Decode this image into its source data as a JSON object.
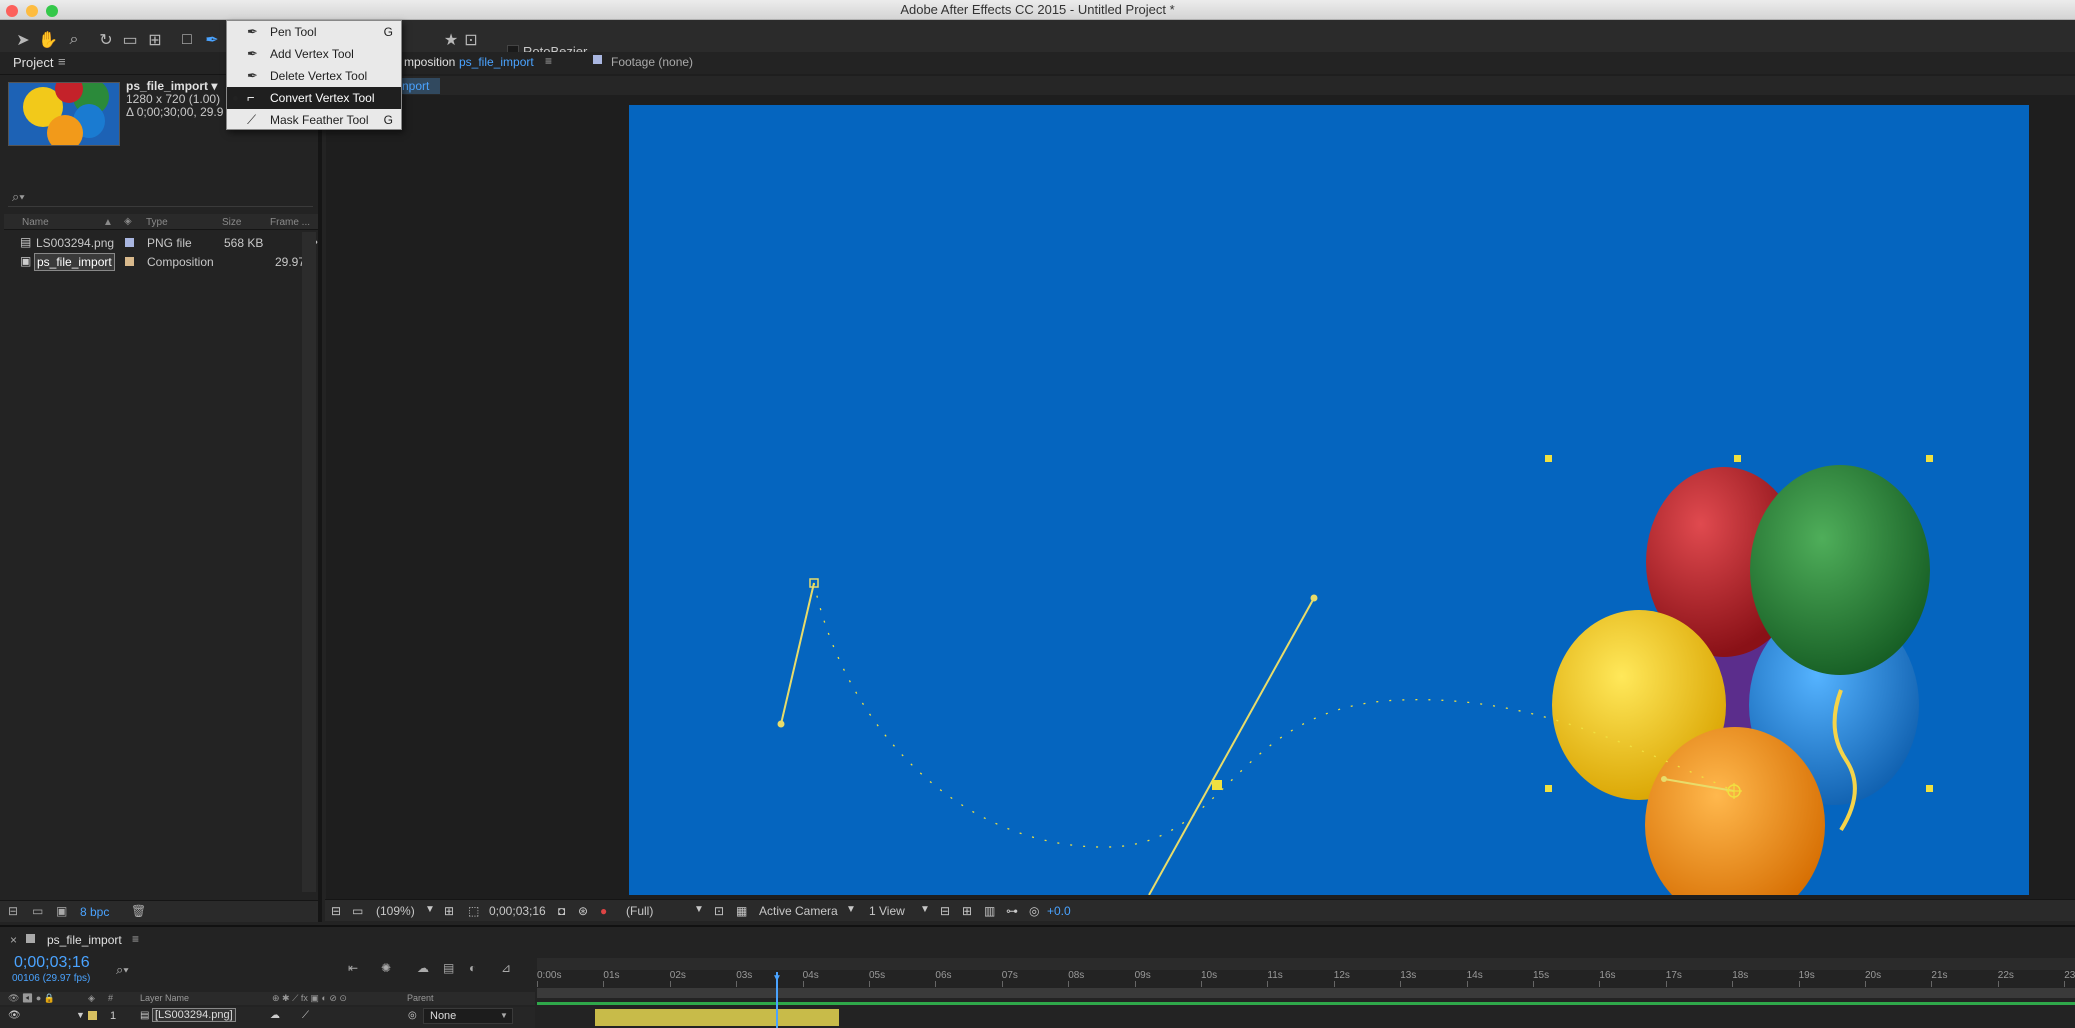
{
  "window": {
    "title": "Adobe After Effects CC 2015 - Untitled Project *",
    "traffic_lights": {
      "close": "#fc605b",
      "minimize": "#fdbc40",
      "zoom": "#34c84a"
    }
  },
  "toolbar": {
    "rotobezier_label": "RotoBezier"
  },
  "tool_menu": {
    "items": [
      {
        "label": "Pen Tool",
        "shortcut": "G",
        "icon": "pen-icon"
      },
      {
        "label": "Add Vertex Tool",
        "shortcut": "",
        "icon": "add-vertex-icon"
      },
      {
        "label": "Delete Vertex Tool",
        "shortcut": "",
        "icon": "delete-vertex-icon"
      },
      {
        "label": "Convert Vertex Tool",
        "shortcut": "",
        "icon": "convert-vertex-icon",
        "selected": true
      },
      {
        "label": "Mask Feather Tool",
        "shortcut": "G",
        "icon": "mask-feather-icon"
      }
    ]
  },
  "project": {
    "tab_label": "Project",
    "menu_glyph": "≡",
    "info": {
      "name": "ps_file_import ▾",
      "dims": "1280 x 720 (1.00)",
      "duration": "Δ 0;00;30;00, 29.9"
    },
    "columns": [
      "Name",
      "Type",
      "Size",
      "Frame ..."
    ],
    "rows": [
      {
        "name": "LS003294.png",
        "type": "PNG file",
        "size": "568 KB",
        "frame": ""
      },
      {
        "name": "ps_file_import",
        "type": "Composition",
        "size": "",
        "frame": "29.97"
      }
    ],
    "bpc_label": "8 bpc"
  },
  "composition": {
    "tab_prefix": "mposition",
    "tab_name": "ps_file_import",
    "footage_tab": "Footage (none)",
    "breadcrumb": "nport",
    "bottom_bar": {
      "zoom": "(109%)",
      "timecode": "0;00;03;16",
      "resolution": "(Full)",
      "camera": "Active Camera",
      "views": "1 View",
      "exposure": "+0.0"
    },
    "background_color": "#0565bf"
  },
  "timeline": {
    "tab_name": "ps_file_import",
    "timecode": "0;00;03;16",
    "frame_info": "00106 (29.97 fps)",
    "layer_header": "Layer Name",
    "parent_header": "Parent",
    "hash_header": "#",
    "ruler_labels": [
      "0:00s",
      "01s",
      "02s",
      "03s",
      "04s",
      "05s",
      "06s",
      "07s",
      "08s",
      "09s",
      "10s",
      "11s",
      "12s",
      "13s",
      "14s",
      "15s",
      "16s",
      "17s",
      "18s",
      "19s",
      "20s",
      "21s",
      "22s",
      "23"
    ],
    "layer": {
      "index": "1",
      "name": "[LS003294.png]",
      "parent": "None"
    }
  }
}
